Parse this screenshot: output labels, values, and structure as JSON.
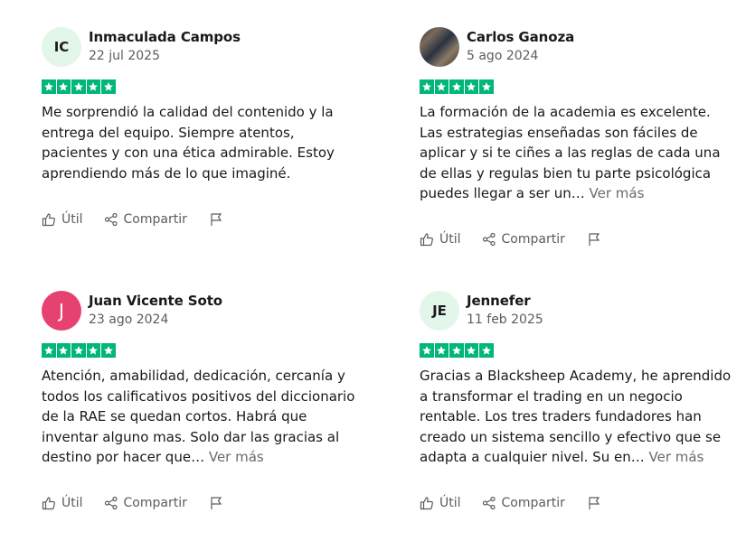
{
  "colors": {
    "star_green": "#00b67a",
    "text": "#191919",
    "muted": "#5c5c5c",
    "avatar_pink": "#e7426f",
    "avatar_light": "#e3f6ea"
  },
  "reviews": [
    {
      "initials": "IC",
      "avatar_style": "light",
      "name": "Inmaculada Campos",
      "date": "22 jul 2025",
      "rating": 5,
      "text": "Me sorprendió la calidad del contenido y la entrega del equipo. Siempre atentos, pacientes y con una ética admirable. Estoy aprendiendo más de lo que imaginé.",
      "more": "",
      "useful_label": "Útil",
      "share_label": "Compartir"
    },
    {
      "initials": "",
      "avatar_style": "photo",
      "name": "Carlos Ganoza",
      "date": "5 ago 2024",
      "rating": 5,
      "text": "La formación de la academia es excelente. Las estrategias enseñadas son fáciles de aplicar y si te ciñes a las reglas de cada una de ellas y regulas bien tu parte psicológica puedes llegar a ser un…",
      "more": "Ver más",
      "useful_label": "Útil",
      "share_label": "Compartir"
    },
    {
      "initials": "J",
      "avatar_style": "pink",
      "name": "Juan Vicente Soto",
      "date": "23 ago 2024",
      "rating": 5,
      "text": "Atención, amabilidad, dedicación, cercanía y todos los calificativos positivos del diccionario de la RAE se quedan cortos. Habrá que inventar alguno mas. Solo dar las gracias al destino por hacer que…",
      "more": "Ver más",
      "useful_label": "Útil",
      "share_label": "Compartir"
    },
    {
      "initials": "JE",
      "avatar_style": "light",
      "name": "Jennefer",
      "date": "11 feb 2025",
      "rating": 5,
      "text": "Gracias a Blacksheep Academy, he aprendido a transformar el trading en un negocio rentable. Los tres traders fundadores han creado un sistema sencillo y efectivo que se adapta a cualquier nivel. Su en…",
      "more": "Ver más",
      "useful_label": "Útil",
      "share_label": "Compartir"
    }
  ]
}
